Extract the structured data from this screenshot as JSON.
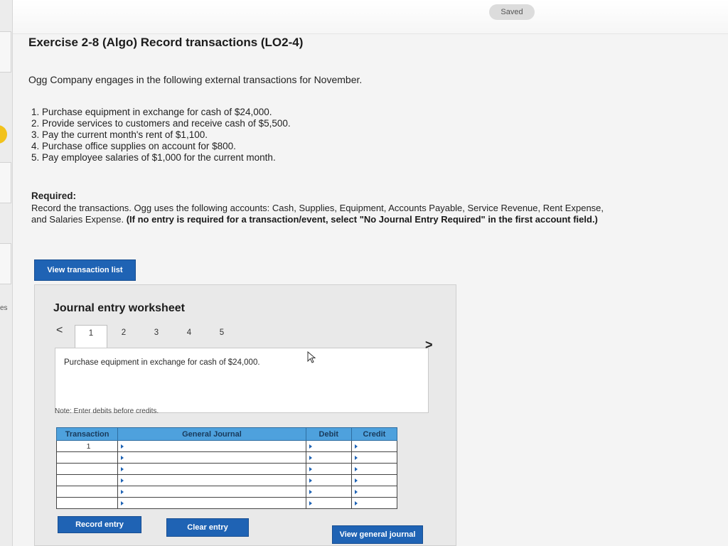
{
  "rail": {
    "side_text": "es"
  },
  "status": {
    "saved": "Saved"
  },
  "exercise": {
    "title": "Exercise 2-8 (Algo) Record transactions (LO2-4)",
    "intro": "Ogg Company engages in the following external transactions for November.",
    "transactions": [
      "1. Purchase equipment in exchange for cash of $24,000.",
      "2. Provide services to customers and receive cash of $5,500.",
      "3. Pay the current month's rent of $1,100.",
      "4. Purchase office supplies on account for $800.",
      "5. Pay employee salaries of $1,000 for the current month."
    ],
    "required_heading": "Required:",
    "required_text": "Record the transactions. Ogg uses the following accounts: Cash, Supplies, Equipment, Accounts Payable, Service Revenue, Rent Expense, and Salaries Expense.",
    "required_bold": "(If no entry is required for a transaction/event, select \"No Journal Entry Required\" in the first account field.)"
  },
  "buttons": {
    "view_transaction_list": "View transaction list",
    "record_entry": "Record entry",
    "clear_entry": "Clear entry",
    "view_general_journal": "View general journal"
  },
  "worksheet": {
    "title": "Journal entry worksheet",
    "prev": "<",
    "next": ">",
    "tabs": [
      "1",
      "2",
      "3",
      "4",
      "5"
    ],
    "description": "Purchase equipment in exchange for cash of $24,000.",
    "note": "Note: Enter debits before credits.",
    "columns": [
      "Transaction",
      "General Journal",
      "Debit",
      "Credit"
    ],
    "rows": [
      "1",
      "",
      "",
      "",
      "",
      ""
    ]
  }
}
